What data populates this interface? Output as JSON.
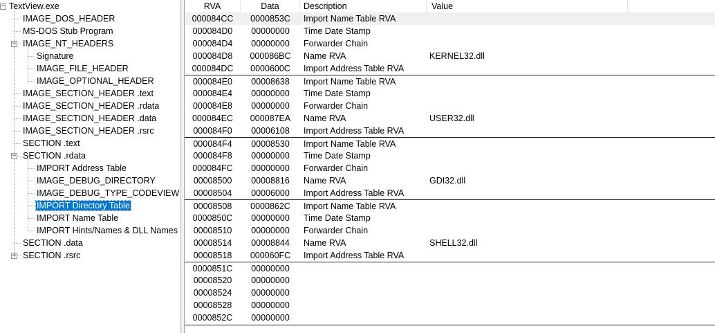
{
  "tree": {
    "items": [
      {
        "label": "TextView.exe",
        "level": 0,
        "expander": "−",
        "selected": false
      },
      {
        "label": "IMAGE_DOS_HEADER",
        "level": 1,
        "selected": false
      },
      {
        "label": "MS-DOS Stub Program",
        "level": 1,
        "selected": false
      },
      {
        "label": "IMAGE_NT_HEADERS",
        "level": 1,
        "expander": "−",
        "selected": false
      },
      {
        "label": "Signature",
        "level": 2,
        "selected": false
      },
      {
        "label": "IMAGE_FILE_HEADER",
        "level": 2,
        "selected": false
      },
      {
        "label": "IMAGE_OPTIONAL_HEADER",
        "level": 2,
        "selected": false
      },
      {
        "label": "IMAGE_SECTION_HEADER .text",
        "level": 1,
        "selected": false
      },
      {
        "label": "IMAGE_SECTION_HEADER .rdata",
        "level": 1,
        "selected": false
      },
      {
        "label": "IMAGE_SECTION_HEADER .data",
        "level": 1,
        "selected": false
      },
      {
        "label": "IMAGE_SECTION_HEADER .rsrc",
        "level": 1,
        "selected": false
      },
      {
        "label": "SECTION .text",
        "level": 1,
        "selected": false
      },
      {
        "label": "SECTION .rdata",
        "level": 1,
        "expander": "−",
        "selected": false
      },
      {
        "label": "IMPORT Address Table",
        "level": 2,
        "selected": false
      },
      {
        "label": "IMAGE_DEBUG_DIRECTORY",
        "level": 2,
        "selected": false
      },
      {
        "label": "IMAGE_DEBUG_TYPE_CODEVIEW",
        "level": 2,
        "selected": false
      },
      {
        "label": "IMPORT Directory Table",
        "level": 2,
        "selected": true
      },
      {
        "label": "IMPORT Name Table",
        "level": 2,
        "selected": false
      },
      {
        "label": "IMPORT Hints/Names & DLL Names",
        "level": 2,
        "selected": false
      },
      {
        "label": "SECTION .data",
        "level": 1,
        "selected": false
      },
      {
        "label": "SECTION .rsrc",
        "level": 1,
        "expander": "+",
        "selected": false
      }
    ]
  },
  "grid": {
    "columns": [
      "RVA",
      "Data",
      "Description",
      "Value"
    ],
    "rows": [
      {
        "rva": "000084CC",
        "data": "0000853C",
        "desc": "Import Name Table RVA",
        "value": "",
        "hl": true
      },
      {
        "rva": "000084D0",
        "data": "00000000",
        "desc": "Time Date Stamp",
        "value": ""
      },
      {
        "rva": "000084D4",
        "data": "00000000",
        "desc": "Forwarder Chain",
        "value": ""
      },
      {
        "rva": "000084D8",
        "data": "000086BC",
        "desc": "Name RVA",
        "value": "KERNEL32.dll"
      },
      {
        "rva": "000084DC",
        "data": "0000600C",
        "desc": "Import Address Table RVA",
        "value": ""
      },
      {
        "rva": "000084E0",
        "data": "00008638",
        "desc": "Import Name Table RVA",
        "value": "",
        "sep": true
      },
      {
        "rva": "000084E4",
        "data": "00000000",
        "desc": "Time Date Stamp",
        "value": ""
      },
      {
        "rva": "000084E8",
        "data": "00000000",
        "desc": "Forwarder Chain",
        "value": ""
      },
      {
        "rva": "000084EC",
        "data": "000087EA",
        "desc": "Name RVA",
        "value": "USER32.dll"
      },
      {
        "rva": "000084F0",
        "data": "00006108",
        "desc": "Import Address Table RVA",
        "value": ""
      },
      {
        "rva": "000084F4",
        "data": "00008530",
        "desc": "Import Name Table RVA",
        "value": "",
        "sep": true
      },
      {
        "rva": "000084F8",
        "data": "00000000",
        "desc": "Time Date Stamp",
        "value": ""
      },
      {
        "rva": "000084FC",
        "data": "00000000",
        "desc": "Forwarder Chain",
        "value": ""
      },
      {
        "rva": "00008500",
        "data": "00008816",
        "desc": "Name RVA",
        "value": "GDI32.dll"
      },
      {
        "rva": "00008504",
        "data": "00006000",
        "desc": "Import Address Table RVA",
        "value": ""
      },
      {
        "rva": "00008508",
        "data": "0000862C",
        "desc": "Import Name Table RVA",
        "value": "",
        "sep": true
      },
      {
        "rva": "0000850C",
        "data": "00000000",
        "desc": "Time Date Stamp",
        "value": ""
      },
      {
        "rva": "00008510",
        "data": "00000000",
        "desc": "Forwarder Chain",
        "value": ""
      },
      {
        "rva": "00008514",
        "data": "00008844",
        "desc": "Name RVA",
        "value": "SHELL32.dll"
      },
      {
        "rva": "00008518",
        "data": "000060FC",
        "desc": "Import Address Table RVA",
        "value": ""
      },
      {
        "rva": "0000851C",
        "data": "00000000",
        "desc": "",
        "value": "",
        "sep": true
      },
      {
        "rva": "00008520",
        "data": "00000000",
        "desc": "",
        "value": ""
      },
      {
        "rva": "00008524",
        "data": "00000000",
        "desc": "",
        "value": ""
      },
      {
        "rva": "00008528",
        "data": "00000000",
        "desc": "",
        "value": ""
      },
      {
        "rva": "0000852C",
        "data": "00000000",
        "desc": "",
        "value": ""
      }
    ]
  }
}
